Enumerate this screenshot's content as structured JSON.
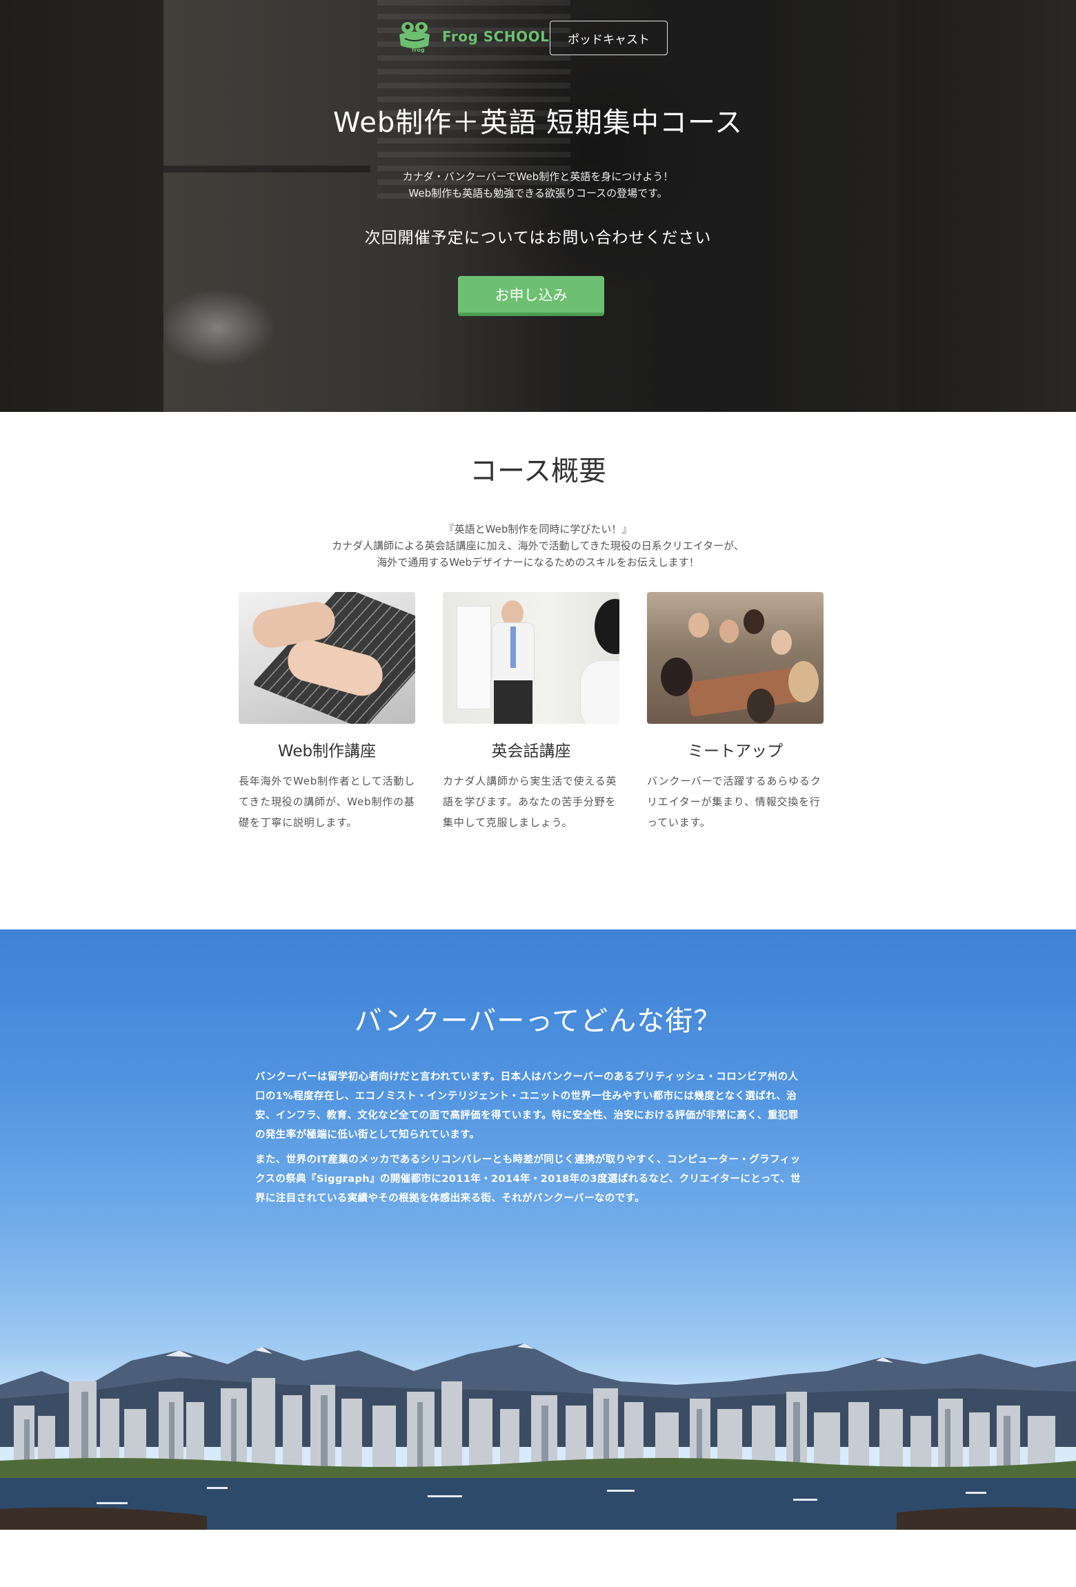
{
  "hero": {
    "logo_text": "Frog SCHOOL",
    "podcast_label": "ポッドキャスト",
    "title": "Web制作＋英語 短期集中コース",
    "subtitle_line1": "カナダ・バンクーバーでWeb制作と英語を身につけよう！",
    "subtitle_line2": "Web制作も英語も勉強できる欲張りコースの登場です。",
    "notice": "次回開催予定についてはお問い合わせください",
    "apply_label": "お申し込み"
  },
  "overview": {
    "title": "コース概要",
    "intro_line1": "『英語とWeb制作を同時に学びたい！』",
    "intro_line2": "カナダ人講師による英会話講座に加え、海外で活動してきた現役の日系クリエイターが、",
    "intro_line3": "海外で通用するWebデザイナーになるためのスキルをお伝えします！",
    "cards": [
      {
        "title": "Web制作講座",
        "text": "長年海外でWeb制作者として活動してきた現役の講師が、Web制作の基礎を丁寧に説明します。"
      },
      {
        "title": "英会話講座",
        "text": "カナダ人講師から実生活で使える英語を学びます。あなたの苦手分野を集中して克服しましょう。"
      },
      {
        "title": "ミートアップ",
        "text": "バンクーバーで活躍するあらゆるクリエイターが集まり、情報交換を行っています。"
      }
    ]
  },
  "vancouver": {
    "title": "バンクーバーってどんな街？",
    "paragraph1": "バンクーバーは留学初心者向けだと言われています。日本人はバンクーバーのあるブリティッシュ・コロンビア州の人口の1%程度存在し、エコノミスト・インテリジェント・ユニットの世界一住みやすい都市には幾度となく選ばれ、治安、インフラ、教育、文化など全ての面で高評価を得ています。特に安全性、治安における評価が非常に高く、重犯罪の発生率が極端に低い街として知られています。",
    "paragraph2": "また、世界のIT産業のメッカであるシリコンバレーとも時差が同じく連携が取りやすく、コンピューター・グラフィックスの祭典『Siggraph』の開催都市に2011年・2014年・2018年の3度選ばれるなど、クリエイターにとって、世界に注目されている実績やその根拠を体感出来る街、それがバンクーバーなのです。"
  },
  "colors": {
    "brand_green": "#6dc071",
    "sky_blue": "#4f93e0"
  },
  "icons": [
    "frog-logo-icon"
  ]
}
